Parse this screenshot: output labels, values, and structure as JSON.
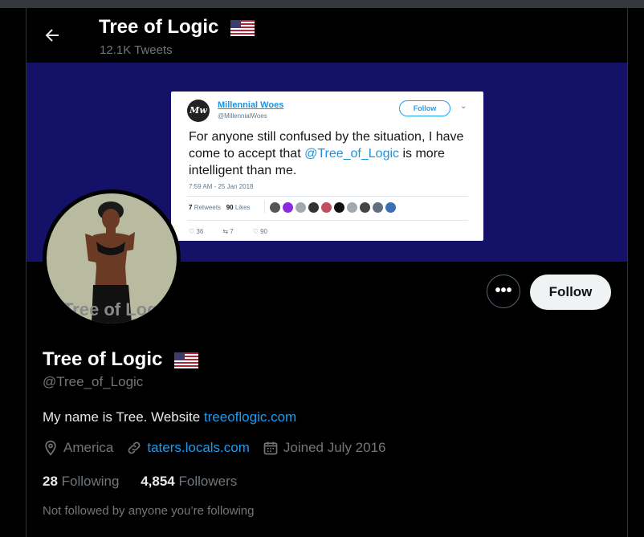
{
  "header": {
    "name": "Tree of Logic",
    "tweets_count": "12.1K Tweets"
  },
  "banner_tweet": {
    "avatar_text": "Mw",
    "name": "Millennial Woes",
    "handle": "@MillennialWoes",
    "follow_label": "Follow",
    "text_before": "For anyone still confused by the situation, I have come to accept that ",
    "mention": "@Tree_of_Logic",
    "text_after": " is more intelligent than me.",
    "timestamp": "7:59 AM - 25 Jan 2018",
    "retweets_count": "7",
    "retweets_label": "Retweets",
    "likes_count": "90",
    "likes_label": "Likes",
    "reply_count": "36",
    "retweet_action_count": "7",
    "like_action_count": "90"
  },
  "profile": {
    "avatar_watermark": "Tree of Logic",
    "more_label": "•••",
    "follow_label": "Follow",
    "name": "Tree of Logic",
    "handle": "@Tree_of_Logic",
    "bio_text": "My name is Tree. Website ",
    "bio_link": "treeoflogic.com",
    "location": "America",
    "website": "taters.locals.com",
    "joined": "Joined July 2016",
    "following_count": "28",
    "following_label": "Following",
    "followers_count": "4,854",
    "followers_label": "Followers",
    "not_followed": "Not followed by anyone you’re following"
  },
  "colors": {
    "banner": "#131168",
    "link": "#1d9bf0",
    "muted": "#71767b"
  }
}
